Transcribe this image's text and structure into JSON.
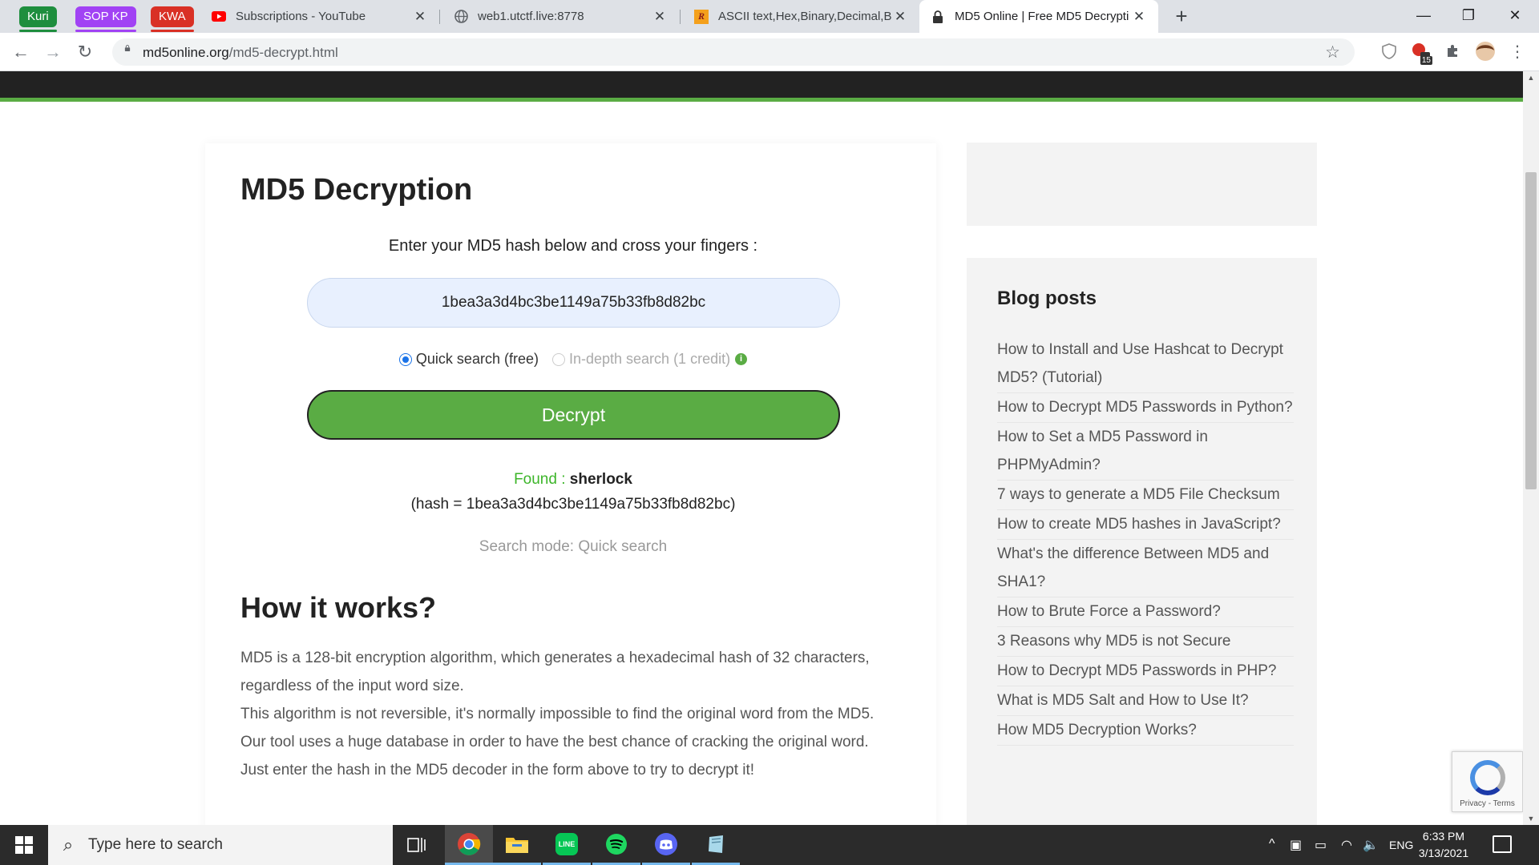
{
  "browser": {
    "tab_groups": [
      {
        "label": "Kuri",
        "color": "#1e8e3e"
      },
      {
        "label": "SOP KP",
        "color": "#a142f4"
      },
      {
        "label": "KWA",
        "color": "#d93025"
      }
    ],
    "tabs": [
      {
        "title": "Subscriptions - YouTube",
        "icon": "youtube-icon"
      },
      {
        "title": "web1.utctf.live:8778",
        "icon": "globe-icon"
      },
      {
        "title": "ASCII text,Hex,Binary,Decimal,Bas",
        "icon": "rapidtables-icon"
      },
      {
        "title": "MD5 Online | Free MD5 Decrypti",
        "icon": "md5online-icon"
      }
    ],
    "new_tab": "+",
    "url_host": "md5online.org",
    "url_path": "/md5-decrypt.html",
    "extension_badge": "15"
  },
  "page": {
    "heading": "MD5 Decryption",
    "prompt": "Enter your MD5 hash below and cross your fingers :",
    "hash_value": "1bea3a3d4bc3be1149a75b33fb8d82bc",
    "radio_quick": "Quick search (free)",
    "radio_indepth": "In-depth search (1 credit)",
    "decrypt_label": "Decrypt",
    "found_label": "Found :",
    "found_word": "sherlock",
    "hash_line": "(hash = 1bea3a3d4bc3be1149a75b33fb8d82bc)",
    "search_mode": "Search mode: Quick search",
    "how_heading": "How it works?",
    "how_paragraphs": [
      "MD5 is a 128-bit encryption algorithm, which generates a hexadecimal hash of 32 characters, regardless of the input word size.",
      "This algorithm is not reversible, it's normally impossible to find the original word from the MD5.",
      "Our tool uses a huge database in order to have the best chance of cracking the original word.",
      "Just enter the hash in the MD5 decoder in the form above to try to decrypt it!"
    ]
  },
  "sidebar": {
    "blog_title": "Blog posts",
    "posts": [
      "How to Install and Use Hashcat to Decrypt MD5? (Tutorial)",
      "How to Decrypt MD5 Passwords in Python?",
      "How to Set a MD5 Password in PHPMyAdmin?",
      "7 ways to generate a MD5 File Checksum",
      "How to create MD5 hashes in JavaScript?",
      "What's the difference Between MD5 and SHA1?",
      "How to Brute Force a Password?",
      "3 Reasons why MD5 is not Secure",
      "How to Decrypt MD5 Passwords in PHP?",
      "What is MD5 Salt and How to Use It?",
      "How MD5 Decryption Works?"
    ]
  },
  "recaptcha": {
    "footer": "Privacy - Terms"
  },
  "taskbar": {
    "search_placeholder": "Type here to search",
    "language": "ENG",
    "time": "6:33 PM",
    "date": "3/13/2021"
  },
  "colors": {
    "accent_green": "#5aac44",
    "found_green": "#3cb529",
    "dark_header": "#222222"
  }
}
